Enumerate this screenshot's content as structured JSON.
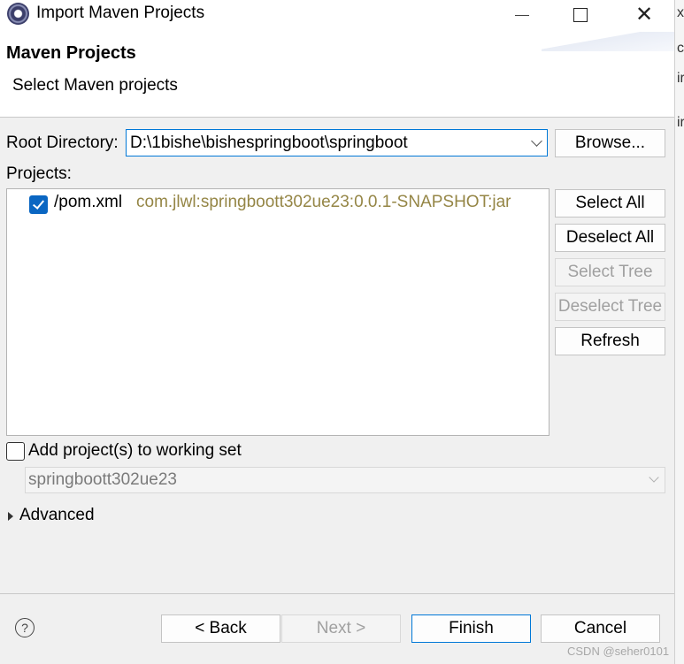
{
  "window": {
    "title": "Import Maven Projects",
    "minimize_glyph": "",
    "maximize_glyph": "",
    "close_glyph": "✕"
  },
  "header": {
    "title": "Maven Projects",
    "subtitle": "Select Maven projects"
  },
  "root_directory": {
    "label": "Root Directory:",
    "value": "D:\\1bishe\\bishespringboot\\springboot",
    "browse_label": "Browse..."
  },
  "projects": {
    "label": "Projects:",
    "items": [
      {
        "checked": true,
        "path": "/pom.xml",
        "artifact": "com.jlwl:springboott302ue23:0.0.1-SNAPSHOT:jar"
      }
    ]
  },
  "side_buttons": {
    "select_all": "Select All",
    "deselect_all": "Deselect All",
    "select_tree": "Select Tree",
    "deselect_tree": "Deselect Tree",
    "refresh": "Refresh"
  },
  "working_set": {
    "label": "Add project(s) to working set",
    "checked": false,
    "value": "springboott302ue23"
  },
  "advanced": {
    "label": "Advanced"
  },
  "footer": {
    "help_glyph": "?",
    "back": "< Back",
    "next": "Next >",
    "finish": "Finish",
    "cancel": "Cancel"
  },
  "background_app_glyphs": [
    "x",
    "c",
    "ir",
    "ir"
  ],
  "watermark": "CSDN @seher0101",
  "colors": {
    "accent": "#0078d7",
    "checkbox_fill": "#0a66c2",
    "artifact_text": "#958646",
    "disabled_text": "#a0a0a0"
  }
}
